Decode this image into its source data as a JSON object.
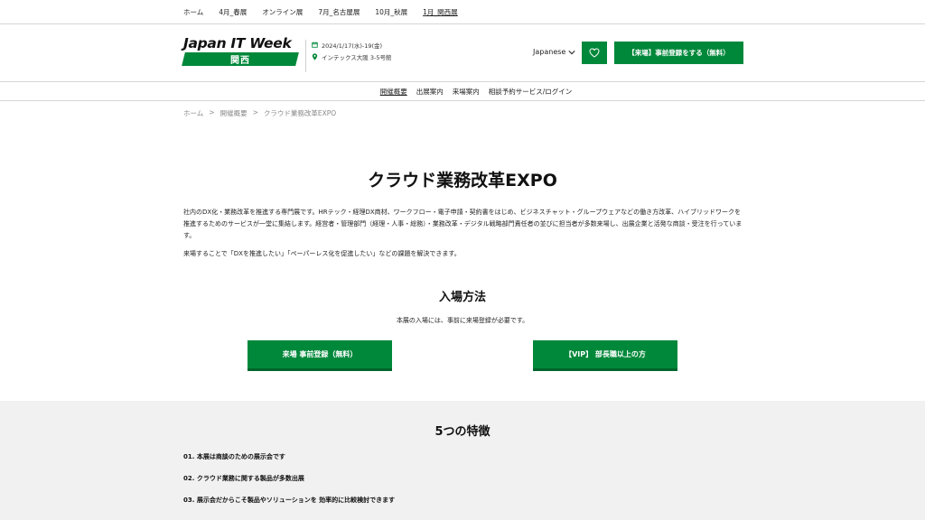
{
  "topnav": {
    "items": [
      {
        "label": "ホーム"
      },
      {
        "label": "4月_春展"
      },
      {
        "label": "オンライン展"
      },
      {
        "label": "7月_名古屋展"
      },
      {
        "label": "10月_秋展"
      },
      {
        "label": "1月_関西展"
      }
    ]
  },
  "header": {
    "logo_title": "Japan IT Week",
    "logo_sub": "関西",
    "date": "2024/1/17(水)-19(金)",
    "venue": "インテックス大阪 3-5号館",
    "language": "Japanese",
    "register_label": "【来場】事前登録をする（無料）"
  },
  "subnav": {
    "items": [
      {
        "label": "開催概要"
      },
      {
        "label": "出展案内"
      },
      {
        "label": "来場案内"
      },
      {
        "label": "相談予約サービス/ログイン"
      }
    ]
  },
  "breadcrumb": {
    "items": [
      "ホーム",
      ">",
      "開催概要",
      ">",
      "クラウド業務改革EXPO"
    ]
  },
  "main": {
    "title": "クラウド業務改革EXPO",
    "description": "社内のDX化・業務改革を推進する専門展です。HRテック・経理DX商材、ワークフロー・電子申請・契約書をはじめ、ビジネスチャット・グループウェアなどの働き方改革、ハイブリッドワークを推進するためのサービスが一堂に集結します。経営者・管理部門（経理・人事・総務）・業務改革・デジタル戦略部門責任者の並びに担当者が多数来場し、出展企業と活発な商談・受注を行っています。",
    "description2": "来場することで「DXを推進したい」「ペーパーレス化を促進したい」などの課題を解決できます。"
  },
  "entry": {
    "title": "入場方法",
    "subtitle": "本展の入場には、事前に来場登録が必要です。",
    "btn_general": "来場 事前登録（無料）",
    "btn_vip": "【VIP】 部長職以上の方"
  },
  "features": {
    "title": "5つの特徴",
    "items": [
      "01. 本展は商談のための展示会です",
      "02. クラウド業務に関する製品が多数出展",
      "03. 展示会だからこそ製品やソリューションを 効率的に比較検討できます"
    ]
  },
  "colors": {
    "accent": "#00883a",
    "accent_dark": "#00652b",
    "section_bg": "#f1f1f1"
  }
}
